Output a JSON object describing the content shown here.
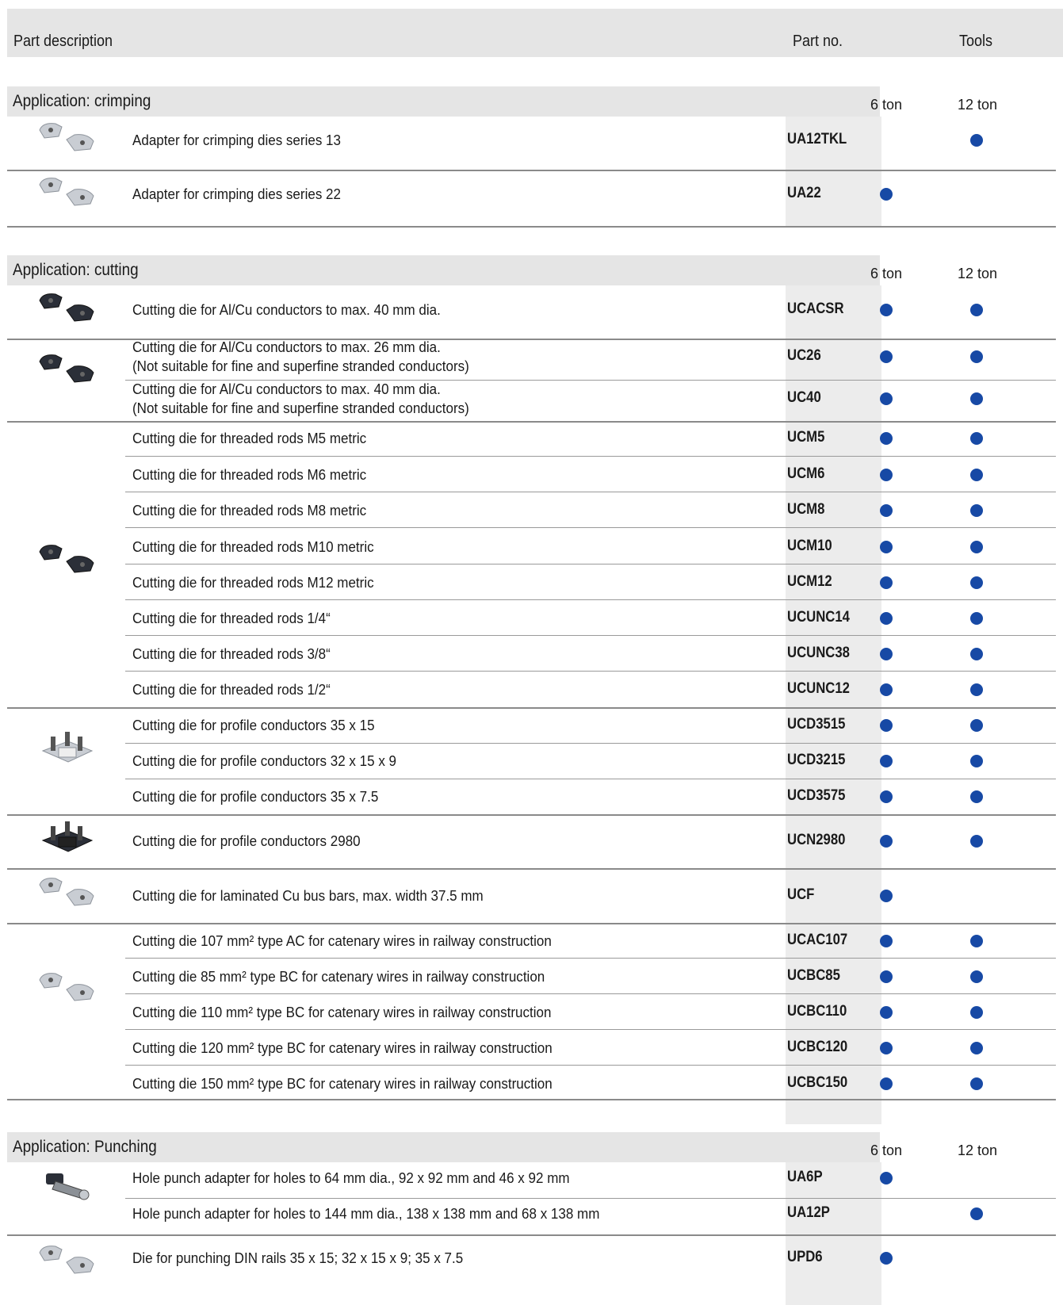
{
  "header": {
    "part_description": "Part description",
    "part_no": "Part no.",
    "tools": "Tools"
  },
  "colors": {
    "dot": "#1749a5",
    "header_bg": "#e5e5e5",
    "partno_bg": "#ececec"
  },
  "sections": [
    {
      "title": "Application: crimping",
      "ton6": "6 ton",
      "ton12": "12 ton",
      "rows": [
        {
          "desc": "Adapter for crimping dies series 13",
          "pno": "UA12TKL",
          "t6": false,
          "t12": true,
          "icon": "adapter-icon"
        },
        {
          "desc": "Adapter for crimping dies series 22",
          "pno": "UA22",
          "t6": true,
          "t12": false,
          "icon": "adapter-icon"
        }
      ]
    },
    {
      "title": "Application: cutting",
      "ton6": "6 ton",
      "ton12": "12 ton",
      "rows": [
        {
          "desc": "Cutting die for Al/Cu conductors to max. 40 mm dia.",
          "pno": "UCACSR",
          "t6": true,
          "t12": true,
          "icon": "cutting-die-icon"
        },
        {
          "desc": "Cutting die for Al/Cu conductors to max. 26 mm dia.",
          "desc2": "(Not suitable for fine and superfine stranded conductors)",
          "pno": "UC26",
          "t6": true,
          "t12": true,
          "icon": "cutting-die-icon"
        },
        {
          "desc": "Cutting die for Al/Cu conductors to max. 40 mm dia.",
          "desc2": "(Not suitable for fine and superfine stranded conductors)",
          "pno": "UC40",
          "t6": true,
          "t12": true
        },
        {
          "desc": "Cutting die for threaded rods M5 metric",
          "pno": "UCM5",
          "t6": true,
          "t12": true,
          "icon": "threaded-rod-die-icon"
        },
        {
          "desc": "Cutting die for threaded rods M6 metric",
          "pno": "UCM6",
          "t6": true,
          "t12": true
        },
        {
          "desc": "Cutting die for threaded rods M8 metric",
          "pno": "UCM8",
          "t6": true,
          "t12": true
        },
        {
          "desc": "Cutting die for threaded rods M10 metric",
          "pno": "UCM10",
          "t6": true,
          "t12": true
        },
        {
          "desc": "Cutting die for threaded rods M12 metric",
          "pno": "UCM12",
          "t6": true,
          "t12": true
        },
        {
          "desc": "Cutting die for threaded rods 1/4“",
          "pno": "UCUNC14",
          "t6": true,
          "t12": true
        },
        {
          "desc": "Cutting die for threaded rods 3/8“",
          "pno": "UCUNC38",
          "t6": true,
          "t12": true
        },
        {
          "desc": "Cutting die for threaded rods 1/2“",
          "pno": "UCUNC12",
          "t6": true,
          "t12": true
        },
        {
          "desc": "Cutting die for profile conductors 35 x 15",
          "pno": "UCD3515",
          "t6": true,
          "t12": true,
          "icon": "profile-die-icon"
        },
        {
          "desc": "Cutting die for profile conductors 32 x 15 x 9",
          "pno": "UCD3215",
          "t6": true,
          "t12": true
        },
        {
          "desc": "Cutting die for profile conductors 35 x 7.5",
          "pno": "UCD3575",
          "t6": true,
          "t12": true
        },
        {
          "desc": "Cutting die for profile conductors 2980",
          "pno": "UCN2980",
          "t6": true,
          "t12": true,
          "icon": "profile-die-2980-icon"
        },
        {
          "desc": "Cutting die for laminated Cu bus bars, max. width 37.5 mm",
          "pno": "UCF",
          "t6": true,
          "t12": false,
          "icon": "bus-bar-die-icon"
        },
        {
          "desc": "Cutting die 107 mm² type AC for catenary wires in railway construction",
          "pno": "UCAC107",
          "t6": true,
          "t12": true,
          "icon": "catenary-die-icon"
        },
        {
          "desc": "Cutting die 85 mm² type BC for catenary wires in railway construction",
          "pno": "UCBC85",
          "t6": true,
          "t12": true
        },
        {
          "desc": "Cutting die 110 mm² type BC for catenary wires in railway construction",
          "pno": "UCBC110",
          "t6": true,
          "t12": true
        },
        {
          "desc": "Cutting die 120 mm² type BC for catenary wires in railway construction",
          "pno": "UCBC120",
          "t6": true,
          "t12": true
        },
        {
          "desc": "Cutting die 150 mm² type BC for catenary wires in railway construction",
          "pno": "UCBC150",
          "t6": true,
          "t12": true
        }
      ]
    },
    {
      "title": "Application: Punching",
      "ton6": "6 ton",
      "ton12": "12 ton",
      "rows": [
        {
          "desc": "Hole punch adapter for holes to 64 mm dia., 92 x 92 mm and 46 x 92 mm",
          "pno": "UA6P",
          "t6": true,
          "t12": false,
          "icon": "hole-punch-adapter-icon"
        },
        {
          "desc": "Hole punch adapter for holes to 144 mm dia., 138 x 138 mm and 68 x 138 mm",
          "pno": "UA12P",
          "t6": false,
          "t12": true
        },
        {
          "desc": "Die for punching DIN rails 35 x 15; 32 x 15 x 9; 35 x 7.5",
          "pno": "UPD6",
          "t6": true,
          "t12": false,
          "icon": "din-rail-punch-die-icon"
        }
      ]
    }
  ]
}
